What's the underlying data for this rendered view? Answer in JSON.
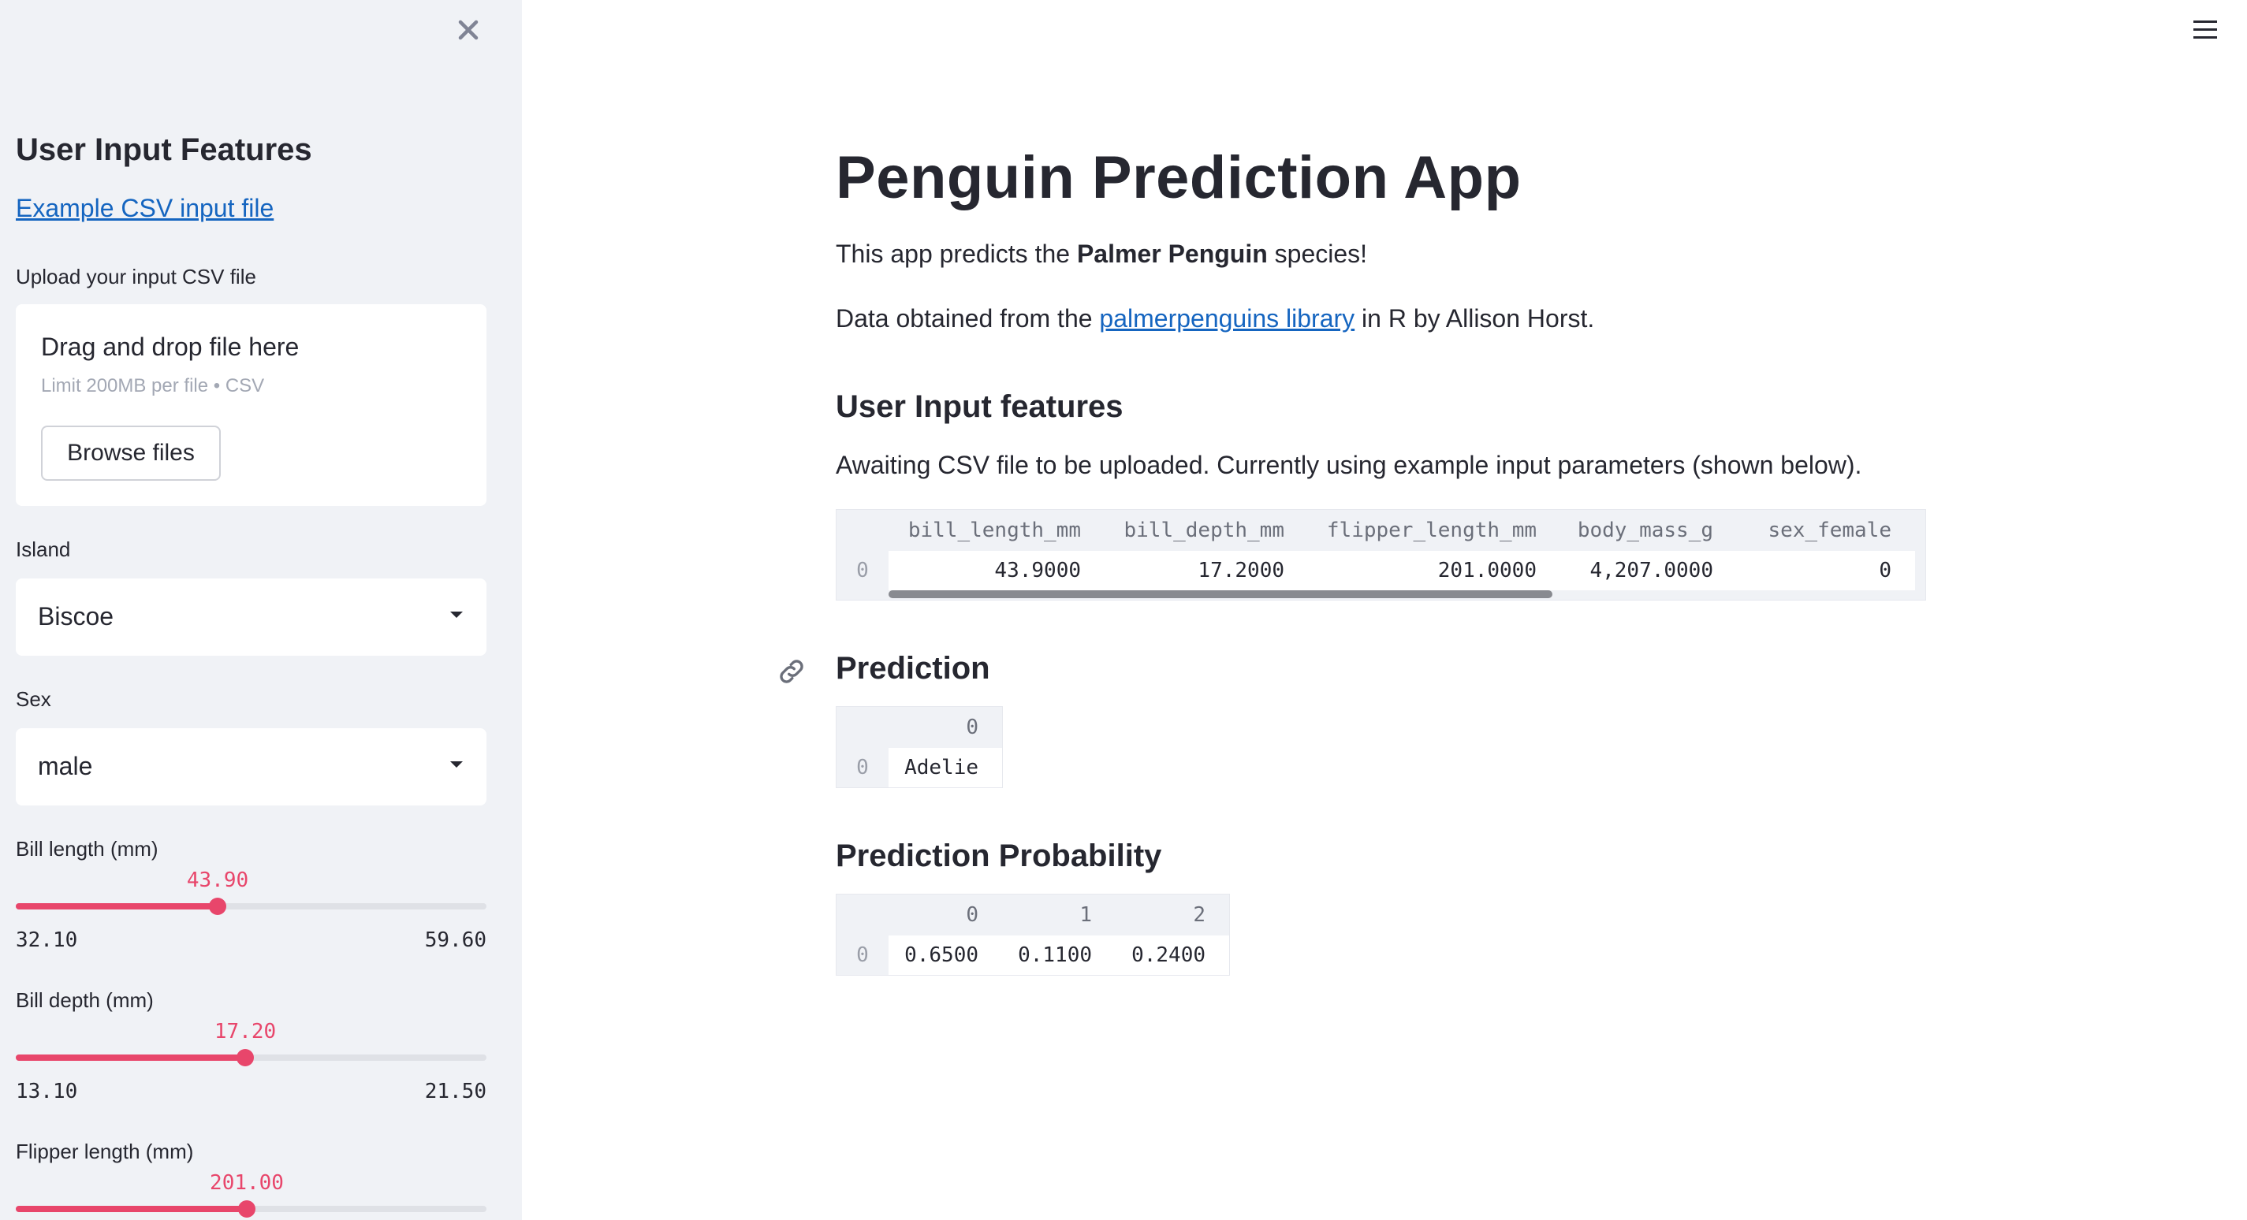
{
  "sidebar": {
    "title": "User Input Features",
    "example_link": "Example CSV input file",
    "upload_label": "Upload your input CSV file",
    "dropzone_main": "Drag and drop file here",
    "dropzone_sub": "Limit 200MB per file • CSV",
    "browse_label": "Browse files",
    "island_label": "Island",
    "island_value": "Biscoe",
    "sex_label": "Sex",
    "sex_value": "male",
    "sliders": [
      {
        "label": "Bill length (mm)",
        "value": "43.90",
        "min": "32.10",
        "max": "59.60",
        "fraction": 0.429
      },
      {
        "label": "Bill depth (mm)",
        "value": "17.20",
        "min": "13.10",
        "max": "21.50",
        "fraction": 0.488
      },
      {
        "label": "Flipper length (mm)",
        "value": "201.00",
        "fraction": 0.49
      }
    ]
  },
  "main": {
    "title": "Penguin Prediction App",
    "intro_pre": "This app predicts the ",
    "intro_bold": "Palmer Penguin",
    "intro_post": " species!",
    "data_pre": "Data obtained from the ",
    "data_link": "palmerpenguins library",
    "data_post": " in R by Allison Horst.",
    "input_heading": "User Input features",
    "awaiting": "Awaiting CSV file to be uploaded. Currently using example input parameters (shown below).",
    "input_table": {
      "columns": [
        "bill_length_mm",
        "bill_depth_mm",
        "flipper_length_mm",
        "body_mass_g",
        "sex_female"
      ],
      "row_index": "0",
      "row": [
        "43.9000",
        "17.2000",
        "201.0000",
        "4,207.0000",
        "0"
      ]
    },
    "prediction_heading": "Prediction",
    "prediction_table": {
      "columns": [
        "0"
      ],
      "row_index": "0",
      "row": [
        "Adelie"
      ]
    },
    "probability_heading": "Prediction Probability",
    "probability_table": {
      "columns": [
        "0",
        "1",
        "2"
      ],
      "row_index": "0",
      "row": [
        "0.6500",
        "0.1100",
        "0.2400"
      ]
    }
  },
  "icons": {
    "close": "close-icon",
    "menu": "hamburger-menu-icon",
    "anchor": "link-anchor-icon",
    "caret": "chevron-down-icon"
  },
  "colors": {
    "accent": "#e8466b",
    "link": "#1565c0",
    "sidebar_bg": "#f0f2f6"
  }
}
